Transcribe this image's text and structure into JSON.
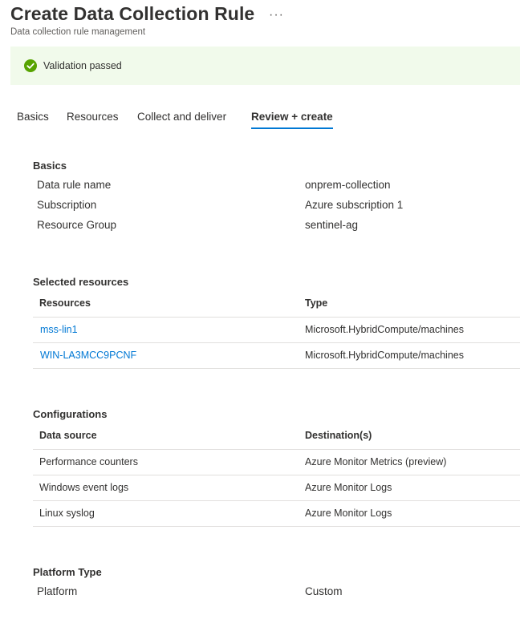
{
  "header": {
    "title": "Create Data Collection Rule",
    "more": "···",
    "subtitle": "Data collection rule management"
  },
  "banner": {
    "message": "Validation passed",
    "icon": "check-circle-icon",
    "color": "#57a300"
  },
  "tabs": [
    {
      "label": "Basics"
    },
    {
      "label": "Resources"
    },
    {
      "label": "Collect and deliver"
    },
    {
      "label": "Review + create",
      "active": true
    }
  ],
  "basics": {
    "title": "Basics",
    "rows": [
      {
        "label": "Data rule name",
        "value": "onprem-collection"
      },
      {
        "label": "Subscription",
        "value": "Azure subscription 1"
      },
      {
        "label": "Resource Group",
        "value": "sentinel-ag"
      }
    ]
  },
  "resources": {
    "title": "Selected resources",
    "columns": [
      "Resources",
      "Type"
    ],
    "rows": [
      {
        "name": "mss-lin1",
        "type": "Microsoft.HybridCompute/machines"
      },
      {
        "name": "WIN-LA3MCC9PCNF",
        "type": "Microsoft.HybridCompute/machines"
      }
    ]
  },
  "configurations": {
    "title": "Configurations",
    "columns": [
      "Data source",
      "Destination(s)"
    ],
    "rows": [
      {
        "source": "Performance counters",
        "destination": "Azure Monitor Metrics (preview)"
      },
      {
        "source": "Windows event logs",
        "destination": "Azure Monitor Logs"
      },
      {
        "source": "Linux syslog",
        "destination": "Azure Monitor Logs"
      }
    ]
  },
  "platform": {
    "title": "Platform Type",
    "rows": [
      {
        "label": "Platform",
        "value": "Custom"
      }
    ]
  },
  "colors": {
    "accent": "#0078d4",
    "success_bg": "#f1faeb",
    "text": "#323130",
    "divider": "#e1dfdd"
  }
}
